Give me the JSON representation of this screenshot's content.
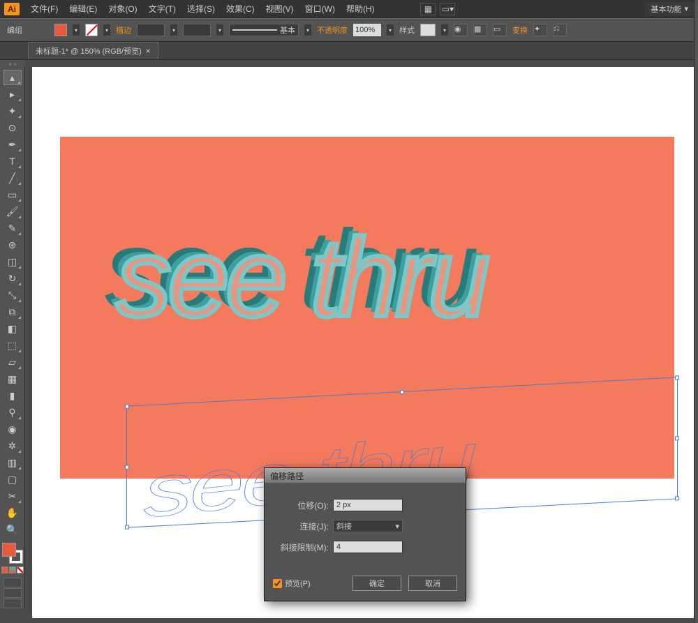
{
  "app": {
    "logo": "Ai"
  },
  "menu": {
    "file": "文件(F)",
    "edit": "编辑(E)",
    "object": "对象(O)",
    "type": "文字(T)",
    "select": "选择(S)",
    "effect": "效果(C)",
    "view": "视图(V)",
    "window": "窗口(W)",
    "help": "帮助(H)"
  },
  "workspace": {
    "label": "基本功能"
  },
  "control": {
    "mode_label": "编组",
    "stroke_label": "描边",
    "stroke_style_label": "基本",
    "opacity_label": "不透明度",
    "opacity_value": "100%",
    "style_label": "样式",
    "transform_label": "变换"
  },
  "tab": {
    "title": "未标题-1* @ 150% (RGB/预览)"
  },
  "artwork": {
    "text": "see thru"
  },
  "dialog": {
    "title": "偏移路径",
    "offset_label": "位移(O):",
    "offset_value": "2 px",
    "join_label": "连接(J):",
    "join_value": "斜接",
    "miter_label": "斜接限制(M):",
    "miter_value": "4",
    "preview_label": "预览(P)",
    "ok": "确定",
    "cancel": "取消"
  },
  "colors": {
    "fill": "#e85a3a",
    "accent": "#f7931e",
    "canvas_bg": "#f47a5e"
  }
}
